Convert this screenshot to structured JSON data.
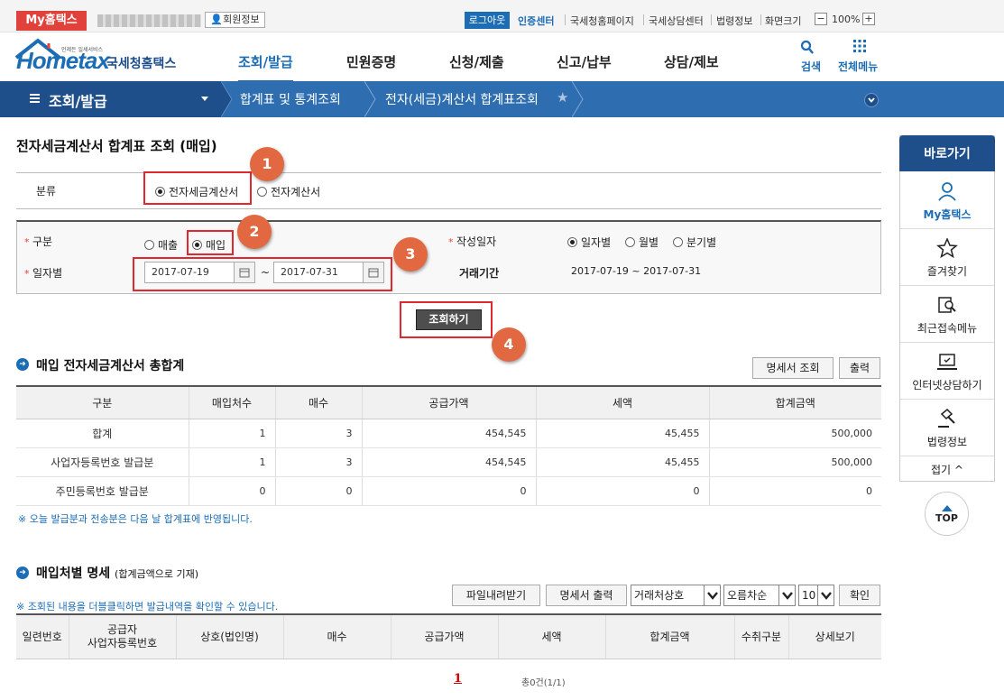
{
  "topbar": {
    "my_badge": "My홈택스",
    "member_info": "회원정보",
    "logout": "로그아웃",
    "cert_center": "인증센터",
    "links": [
      "국세청홈페이지",
      "국세상담센터",
      "법령정보",
      "화면크기"
    ],
    "zoom": "100%",
    "zoom_minus": "−",
    "zoom_plus": "+"
  },
  "header": {
    "logo_small": "언제든 일세서비스",
    "logo_main": "Hometax",
    "logo_kr": "국세청홈택스",
    "nav": [
      "조회/발급",
      "민원증명",
      "신청/제출",
      "신고/납부",
      "상담/제보"
    ],
    "search_label": "검색",
    "menu_label": "전체메뉴"
  },
  "breadcrumb": {
    "title": "조회/발급",
    "items": [
      "합계표 및 통계조회",
      "전자(세금)계산서 합계표조회"
    ]
  },
  "page": {
    "title": "전자세금계산서 합계표 조회 (매입)",
    "category": {
      "label": "분류",
      "options": [
        "전자세금계산서",
        "전자계산서"
      ],
      "selected": "전자세금계산서"
    },
    "form": {
      "type_label": "구분",
      "type_options": [
        "매출",
        "매입"
      ],
      "type_selected": "매입",
      "date_label": "일자별",
      "date_from": "2017-07-19",
      "date_to": "2017-07-31",
      "tilde": "~",
      "write_label": "작성일자",
      "write_options": [
        "일자별",
        "월별",
        "분기별"
      ],
      "write_selected": "일자별",
      "period_label": "거래기간",
      "period_value": "2017-07-19 ~ 2017-07-31"
    },
    "search_button": "조회하기",
    "callouts": [
      "1",
      "2",
      "3",
      "4"
    ]
  },
  "summary": {
    "title": "매입 전자세금계산서 총합계",
    "btn_detail": "명세서 조회",
    "btn_print": "출력",
    "columns": [
      "구분",
      "매입처수",
      "매수",
      "공급가액",
      "세액",
      "합계금액"
    ],
    "rows": [
      [
        "합계",
        "1",
        "3",
        "454,545",
        "45,455",
        "500,000"
      ],
      [
        "사업자등록번호 발급분",
        "1",
        "3",
        "454,545",
        "45,455",
        "500,000"
      ],
      [
        "주민등록번호 발급분",
        "0",
        "0",
        "0",
        "0",
        "0"
      ]
    ],
    "note": "※ 오늘 발급분과 전송분은 다음 날 합계표에 반영됩니다."
  },
  "detail": {
    "title": "매입처별 명세",
    "subtitle": "(합계금액으로 기재)",
    "note": "※ 조회된 내용을 더블클릭하면 발급내역을 확인할 수 있습니다.",
    "btn_download": "파일내려받기",
    "btn_print": "명세서 출력",
    "sort_field": "거래처상호",
    "sort_order": "오름차순",
    "page_size": "10",
    "btn_confirm": "확인",
    "columns": [
      "일련번호",
      "공급자\n사업자등록번호",
      "상호(법인명)",
      "매수",
      "공급가액",
      "세액",
      "합계금액",
      "수취구분",
      "상세보기"
    ],
    "pager_page": "1",
    "pager_total": "총0건(1/1)"
  },
  "quick": {
    "title": "바로가기",
    "items": [
      {
        "label": "My홈택스",
        "icon": "person-icon"
      },
      {
        "label": "즐겨찾기",
        "icon": "star-icon"
      },
      {
        "label": "최근접속메뉴",
        "icon": "recent-search-icon"
      },
      {
        "label": "인터넷상담하기",
        "icon": "laptop-icon"
      },
      {
        "label": "법령정보",
        "icon": "gavel-icon"
      }
    ],
    "collapse": "접기 ^",
    "top": "TOP"
  },
  "colors": {
    "brand_blue": "#1c6db4",
    "nav_dark": "#1e4f8a",
    "accent_red": "#e0413a",
    "callout": "#e26841"
  }
}
